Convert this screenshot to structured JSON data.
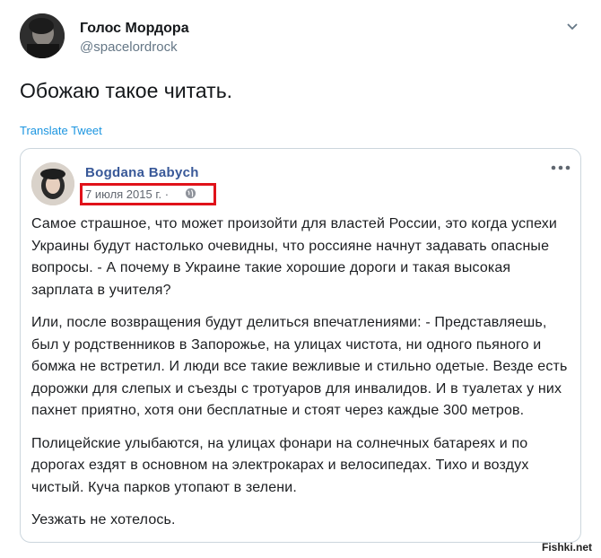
{
  "tweet": {
    "display_name": "Голос Мордора",
    "handle": "@spacelordrock",
    "text": "Обожаю такое читать.",
    "translate_label": "Translate Tweet"
  },
  "facebook_post": {
    "author": "Bogdana Babych",
    "date": "7 июля 2015 г. ·",
    "paragraphs": [
      "Самое страшное, что может произойти для властей России, это когда успехи Украины будут настолько очевидны, что россияне начнут задавать опасные вопросы. - А почему в Украине такие хорошие дороги и такая высокая зарплата в учителя?",
      "Или, после возвращения будут делиться впечатлениями: - Представляешь, был у родственников в Запорожье, на улицах чистота, ни одного пьяного и бомжа не встретил. И люди все такие вежливые и стильно одетые. Везде есть дорожки для слепых и съезды с тротуаров для инвалидов. И в туалетах у них пахнет приятно, хотя они бесплатные и стоят через каждые 300 метров.",
      "Полицейские улыбаются, на улицах фонари на солнечных батареях и по дорогах ездят в основном на электрокарах и велосипедах. Тихо и воздух чистый. Куча парков утопают в зелени.",
      "Уезжать не хотелось."
    ]
  },
  "watermark": "Fishki.net",
  "colors": {
    "link": "#1b95e0",
    "fb_author": "#385898",
    "highlight_box": "#e0121a",
    "card_border": "#ccd6dd"
  },
  "icons": [
    "chevron-down-icon",
    "globe-icon",
    "more-icon"
  ]
}
